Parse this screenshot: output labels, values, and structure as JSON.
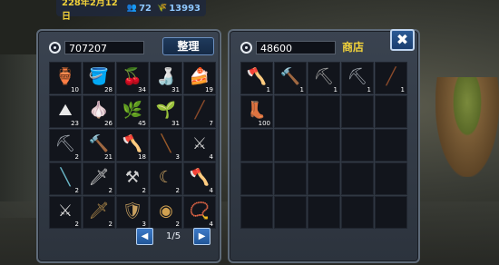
{
  "status": {
    "date": "228年2月12日",
    "population": "72",
    "grain": "13993"
  },
  "inventory": {
    "money": "707207",
    "sort_label": "整理",
    "page": "1/5",
    "slots": [
      {
        "icon": "pot-icon",
        "glyph": "🏺",
        "color": "#c0583b",
        "qty": "10"
      },
      {
        "icon": "bucket-icon",
        "glyph": "🪣",
        "color": "#9a7a3e",
        "qty": "28"
      },
      {
        "icon": "cherries-icon",
        "glyph": "🍒",
        "color": "#c9283b",
        "qty": "34"
      },
      {
        "icon": "wine-jar-icon",
        "glyph": "🍶",
        "color": "#e8e0d8",
        "qty": "31"
      },
      {
        "icon": "cake-icon",
        "glyph": "🍰",
        "color": "#c99a5a",
        "qty": "19"
      },
      {
        "icon": "salt-pile-icon",
        "glyph": "⛰",
        "color": "#e8e8e8",
        "qty": "23"
      },
      {
        "icon": "garlic-icon",
        "glyph": "🧄",
        "color": "#e3d9c4",
        "qty": "26"
      },
      {
        "icon": "ginseng-icon",
        "glyph": "🌿",
        "color": "#8a6a3a",
        "qty": "45"
      },
      {
        "icon": "scallion-icon",
        "glyph": "🌱",
        "color": "#6ec24a",
        "qty": "31"
      },
      {
        "icon": "bamboo-flute-icon",
        "glyph": "╱",
        "color": "#8a4a2a",
        "qty": "7"
      },
      {
        "icon": "shovel-icon",
        "glyph": "⛏",
        "color": "#9aa0a8",
        "qty": "2"
      },
      {
        "icon": "hammer-icon",
        "glyph": "🔨",
        "color": "#b3b3b3",
        "qty": "21"
      },
      {
        "icon": "axe-icon",
        "glyph": "🪓",
        "color": "#7c9a66",
        "qty": "18"
      },
      {
        "icon": "club-icon",
        "glyph": "╲",
        "color": "#9a5a2a",
        "qty": "3"
      },
      {
        "icon": "halberd-icon",
        "glyph": "⚔",
        "color": "#c8c8c8",
        "qty": "4"
      },
      {
        "icon": "lance-icon",
        "glyph": "╲",
        "color": "#6ab7c8",
        "qty": "2"
      },
      {
        "icon": "dagger-icon",
        "glyph": "🗡",
        "color": "#d8d8d8",
        "qty": "2"
      },
      {
        "icon": "battle-axe-icon",
        "glyph": "⚒",
        "color": "#d0d0d0",
        "qty": "2"
      },
      {
        "icon": "crescent-blade-icon",
        "glyph": "☾",
        "color": "#c8a060",
        "qty": "2"
      },
      {
        "icon": "broad-axe-icon",
        "glyph": "🪓",
        "color": "#c8c8c8",
        "qty": "4"
      },
      {
        "icon": "sabre-icon",
        "glyph": "⚔",
        "color": "#d8d8d8",
        "qty": "2"
      },
      {
        "icon": "spear-icon",
        "glyph": "🗡",
        "color": "#b08a4a",
        "qty": "2"
      },
      {
        "icon": "shield-icon",
        "glyph": "🛡",
        "color": "#c8a060",
        "qty": "3"
      },
      {
        "icon": "round-shield-icon",
        "glyph": "◉",
        "color": "#d0a050",
        "qty": "2"
      },
      {
        "icon": "necklace-icon",
        "glyph": "📿",
        "color": "#3aa0e0",
        "qty": "4"
      }
    ]
  },
  "shop": {
    "money": "48600",
    "title": "商店",
    "close_label": "✖",
    "slots": [
      {
        "icon": "axe-icon",
        "glyph": "🪓",
        "color": "#7c9a66",
        "qty": "1"
      },
      {
        "icon": "hammer-icon",
        "glyph": "🔨",
        "color": "#b3b3b3",
        "qty": "1"
      },
      {
        "icon": "pickaxe-icon",
        "glyph": "⛏",
        "color": "#9a9a9a",
        "qty": "1"
      },
      {
        "icon": "shovel-icon",
        "glyph": "⛏",
        "color": "#9aa0a8",
        "qty": "1"
      },
      {
        "icon": "bamboo-flute-icon",
        "glyph": "╱",
        "color": "#8a4a2a",
        "qty": "1"
      },
      {
        "icon": "green-boots-icon",
        "glyph": "👢",
        "color": "#3dbf6a",
        "qty": "100"
      },
      {
        "icon": "",
        "glyph": "",
        "color": "",
        "qty": ""
      },
      {
        "icon": "",
        "glyph": "",
        "color": "",
        "qty": ""
      },
      {
        "icon": "",
        "glyph": "",
        "color": "",
        "qty": ""
      },
      {
        "icon": "",
        "glyph": "",
        "color": "",
        "qty": ""
      },
      {
        "icon": "",
        "glyph": "",
        "color": "",
        "qty": ""
      },
      {
        "icon": "",
        "glyph": "",
        "color": "",
        "qty": ""
      },
      {
        "icon": "",
        "glyph": "",
        "color": "",
        "qty": ""
      },
      {
        "icon": "",
        "glyph": "",
        "color": "",
        "qty": ""
      },
      {
        "icon": "",
        "glyph": "",
        "color": "",
        "qty": ""
      },
      {
        "icon": "",
        "glyph": "",
        "color": "",
        "qty": ""
      },
      {
        "icon": "",
        "glyph": "",
        "color": "",
        "qty": ""
      },
      {
        "icon": "",
        "glyph": "",
        "color": "",
        "qty": ""
      },
      {
        "icon": "",
        "glyph": "",
        "color": "",
        "qty": ""
      },
      {
        "icon": "",
        "glyph": "",
        "color": "",
        "qty": ""
      },
      {
        "icon": "",
        "glyph": "",
        "color": "",
        "qty": ""
      },
      {
        "icon": "",
        "glyph": "",
        "color": "",
        "qty": ""
      },
      {
        "icon": "",
        "glyph": "",
        "color": "",
        "qty": ""
      },
      {
        "icon": "",
        "glyph": "",
        "color": "",
        "qty": ""
      },
      {
        "icon": "",
        "glyph": "",
        "color": "",
        "qty": ""
      }
    ]
  }
}
